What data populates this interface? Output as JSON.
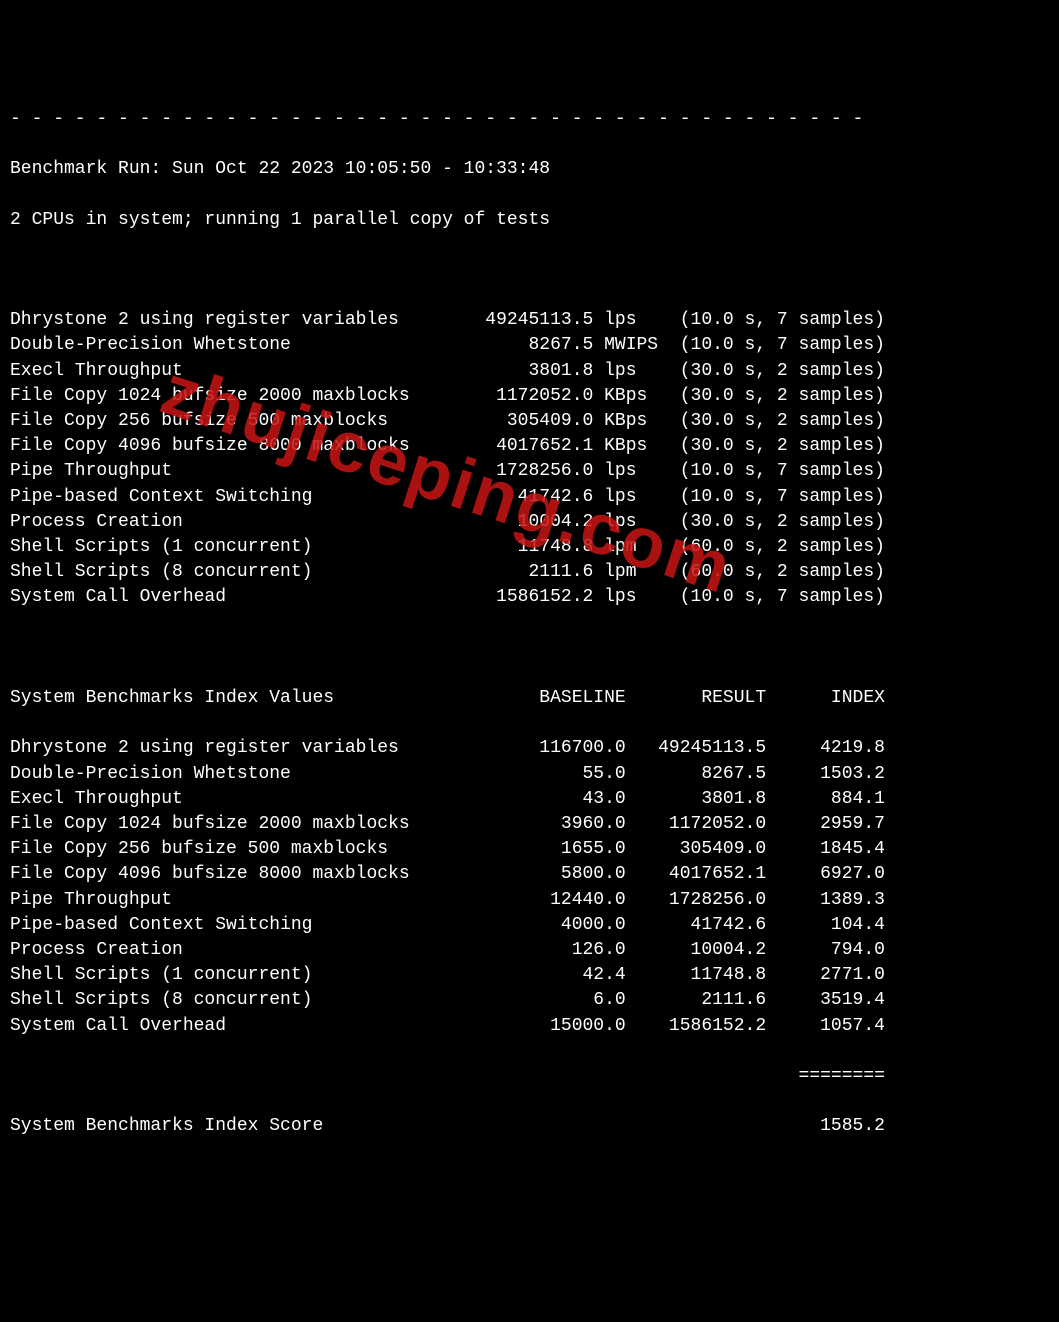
{
  "separator": "- - - - - - - - - - - - - - - - - - - - - - - - - - - - - - - - - - - - - - - -",
  "header": {
    "run_line": "Benchmark Run: Sun Oct 22 2023 10:05:50 - 10:33:48",
    "cpu_line": "2 CPUs in system; running 1 parallel copy of tests"
  },
  "tests": [
    {
      "name": "Dhrystone 2 using register variables",
      "value": "49245113.5",
      "unit": "lps",
      "time": "10.0",
      "samples": "7"
    },
    {
      "name": "Double-Precision Whetstone",
      "value": "8267.5",
      "unit": "MWIPS",
      "time": "10.0",
      "samples": "7"
    },
    {
      "name": "Execl Throughput",
      "value": "3801.8",
      "unit": "lps",
      "time": "30.0",
      "samples": "2"
    },
    {
      "name": "File Copy 1024 bufsize 2000 maxblocks",
      "value": "1172052.0",
      "unit": "KBps",
      "time": "30.0",
      "samples": "2"
    },
    {
      "name": "File Copy 256 bufsize 500 maxblocks",
      "value": "305409.0",
      "unit": "KBps",
      "time": "30.0",
      "samples": "2"
    },
    {
      "name": "File Copy 4096 bufsize 8000 maxblocks",
      "value": "4017652.1",
      "unit": "KBps",
      "time": "30.0",
      "samples": "2"
    },
    {
      "name": "Pipe Throughput",
      "value": "1728256.0",
      "unit": "lps",
      "time": "10.0",
      "samples": "7"
    },
    {
      "name": "Pipe-based Context Switching",
      "value": "41742.6",
      "unit": "lps",
      "time": "10.0",
      "samples": "7"
    },
    {
      "name": "Process Creation",
      "value": "10004.2",
      "unit": "lps",
      "time": "30.0",
      "samples": "2"
    },
    {
      "name": "Shell Scripts (1 concurrent)",
      "value": "11748.8",
      "unit": "lpm",
      "time": "60.0",
      "samples": "2"
    },
    {
      "name": "Shell Scripts (8 concurrent)",
      "value": "2111.6",
      "unit": "lpm",
      "time": "60.0",
      "samples": "2"
    },
    {
      "name": "System Call Overhead",
      "value": "1586152.2",
      "unit": "lps",
      "time": "10.0",
      "samples": "7"
    }
  ],
  "index_header": {
    "title": "System Benchmarks Index Values",
    "col_baseline": "BASELINE",
    "col_result": "RESULT",
    "col_index": "INDEX"
  },
  "index_rows": [
    {
      "name": "Dhrystone 2 using register variables",
      "baseline": "116700.0",
      "result": "49245113.5",
      "index": "4219.8"
    },
    {
      "name": "Double-Precision Whetstone",
      "baseline": "55.0",
      "result": "8267.5",
      "index": "1503.2"
    },
    {
      "name": "Execl Throughput",
      "baseline": "43.0",
      "result": "3801.8",
      "index": "884.1"
    },
    {
      "name": "File Copy 1024 bufsize 2000 maxblocks",
      "baseline": "3960.0",
      "result": "1172052.0",
      "index": "2959.7"
    },
    {
      "name": "File Copy 256 bufsize 500 maxblocks",
      "baseline": "1655.0",
      "result": "305409.0",
      "index": "1845.4"
    },
    {
      "name": "File Copy 4096 bufsize 8000 maxblocks",
      "baseline": "5800.0",
      "result": "4017652.1",
      "index": "6927.0"
    },
    {
      "name": "Pipe Throughput",
      "baseline": "12440.0",
      "result": "1728256.0",
      "index": "1389.3"
    },
    {
      "name": "Pipe-based Context Switching",
      "baseline": "4000.0",
      "result": "41742.6",
      "index": "104.4"
    },
    {
      "name": "Process Creation",
      "baseline": "126.0",
      "result": "10004.2",
      "index": "794.0"
    },
    {
      "name": "Shell Scripts (1 concurrent)",
      "baseline": "42.4",
      "result": "11748.8",
      "index": "2771.0"
    },
    {
      "name": "Shell Scripts (8 concurrent)",
      "baseline": "6.0",
      "result": "2111.6",
      "index": "3519.4"
    },
    {
      "name": "System Call Overhead",
      "baseline": "15000.0",
      "result": "1586152.2",
      "index": "1057.4"
    }
  ],
  "score_separator": "========",
  "final_score": {
    "label": "System Benchmarks Index Score",
    "value": "1585.2"
  },
  "watermark": "zhujiceping.com"
}
